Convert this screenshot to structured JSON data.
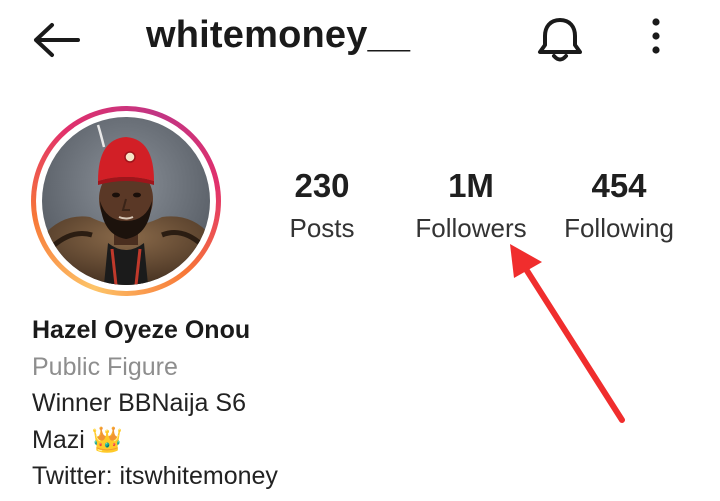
{
  "header": {
    "username": "whitemoney__",
    "back_icon": "arrow-left-icon",
    "bell_icon": "bell-icon",
    "more_icon": "more-vertical-icon"
  },
  "stats": {
    "posts": {
      "value": "230",
      "label": "Posts"
    },
    "followers": {
      "value": "1M",
      "label": "Followers"
    },
    "following": {
      "value": "454",
      "label": "Following"
    }
  },
  "bio": {
    "name": "Hazel Oyeze Onou",
    "category": "Public Figure",
    "line1": "Winner BBNaija S6",
    "line2": "Mazi 👑",
    "line3": "Twitter: itswhitemoney"
  },
  "colors": {
    "annotation_arrow": "#f02d2d",
    "category_text": "#8e8e8e",
    "story_ring": [
      "#fdc468",
      "#f77737",
      "#e1306c",
      "#c13584"
    ]
  }
}
